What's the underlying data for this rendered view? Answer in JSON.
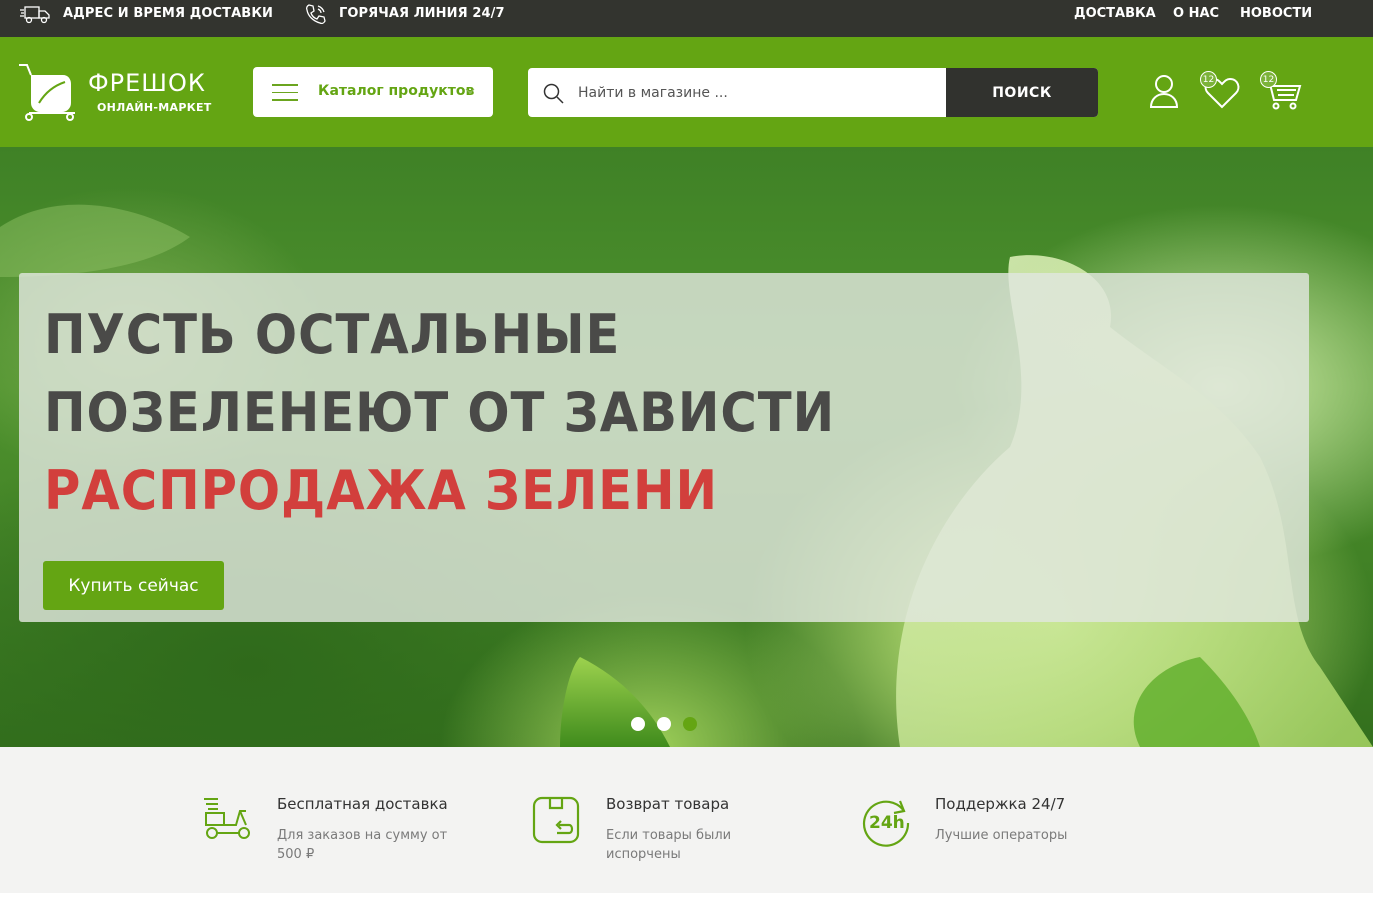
{
  "topbar": {
    "delivery_info": "АДРЕС И ВРЕМЯ ДОСТАВКИ",
    "hotline": "ГОРЯЧАЯ ЛИНИЯ 24/7",
    "nav": [
      "ДОСТАВКА",
      "О НАС",
      "НОВОСТИ"
    ],
    "icons": [
      "delivery-truck-icon",
      "phone-icon"
    ]
  },
  "header": {
    "logo_name": "ФРЕШОК",
    "logo_sub": "ОНЛАЙН-МАРКЕТ",
    "catalog_label": "Каталог продуктов",
    "search_placeholder": "Найти в магазине ...",
    "search_button": "ПОИСК",
    "wishlist_count": "12",
    "cart_count": "12",
    "icons": [
      "cart-logo-icon",
      "menu-icon",
      "chevron-down-icon",
      "search-icon",
      "user-icon",
      "heart-icon",
      "cart-icon"
    ]
  },
  "hero": {
    "line1": "ПУСТЬ ОСТАЛЬНЫЕ",
    "line2": "ПОЗЕЛЕНЕЮТ ОТ ЗАВИСТИ",
    "line3": "РАСПРОДАЖА ЗЕЛЕНИ",
    "cta": "Купить сейчас",
    "slides_total": 3,
    "active_slide": 3
  },
  "features": [
    {
      "title": "Бесплатная доставка",
      "desc": "Для заказов на сумму от 500 ₽",
      "icon": "scooter-icon"
    },
    {
      "title": "Возврат товара",
      "desc": "Если товары были испорчены",
      "icon": "return-icon"
    },
    {
      "title": "Поддержка 24/7",
      "desc": "Лучшие операторы",
      "icon": "support-24h-icon"
    }
  ],
  "colors": {
    "brand_green": "#64a513",
    "dark": "#33342f",
    "accent_red": "#d23f3c"
  }
}
